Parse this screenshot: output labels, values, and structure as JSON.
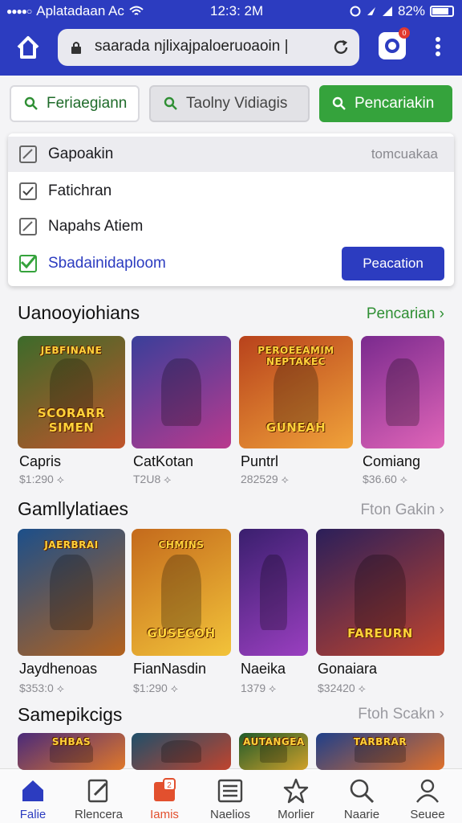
{
  "status": {
    "carrier": "Aplatadaan Ac",
    "time": "12:3: 2M",
    "battery": "82%"
  },
  "browser": {
    "url": "saarada njlixajpaloeruoaoin |",
    "tab_badge": "0"
  },
  "search_chips": [
    {
      "label": "Feriaegiann"
    },
    {
      "label": "Taolny Vidiagis"
    },
    {
      "label": "Pencariakin"
    }
  ],
  "panel": {
    "rows": [
      {
        "label": "Gapoakin",
        "hint": "tomcuakaa"
      },
      {
        "label": "Fatichran"
      },
      {
        "label": "Napahs Atiem"
      },
      {
        "label": "Sbadainidaploom",
        "action": "Peacation"
      }
    ]
  },
  "sections": [
    {
      "title": "Uanooyiohians",
      "link": "Pencarian",
      "items": [
        {
          "name": "Capris",
          "price": "$1:290",
          "caption_top": "JEBFINANE",
          "caption": "SCORARR SIMEN",
          "color1": "#3c6b2a",
          "color2": "#c0542b"
        },
        {
          "name": "CatKotan",
          "price": "T2U8",
          "caption": "",
          "color1": "#3a3f9a",
          "color2": "#b93a8e"
        },
        {
          "name": "Puntrl",
          "price": "282529",
          "caption_top": "PEROEEAMIM NEPTAKEC",
          "caption": "GUNEAH",
          "color1": "#b8421c",
          "color2": "#f0a23a"
        },
        {
          "name": "Comiang",
          "price": "$36.60",
          "caption": "",
          "color1": "#7a2a8e",
          "color2": "#e065b8"
        }
      ]
    },
    {
      "title": "Gamllylatiaes",
      "link": "Fton Gakin",
      "items": [
        {
          "name": "Jaydhenoas",
          "price": "$353:0",
          "caption_top": "JAERBRAI",
          "caption": "",
          "color1": "#1c4f8a",
          "color2": "#b3621e"
        },
        {
          "name": "FianNasdin",
          "price": "$1:290",
          "caption_top": "CHMINS",
          "caption": "GUSECOH",
          "color1": "#c46a1c",
          "color2": "#f2c33a"
        },
        {
          "name": "Naeika",
          "price": "1379",
          "caption": "",
          "color1": "#3a1f6e",
          "color2": "#9a3fc0"
        },
        {
          "name": "Gonaiara",
          "price": "$32420",
          "caption": "FAREURN",
          "color1": "#2b1f5a",
          "color2": "#c0442e"
        }
      ]
    },
    {
      "title": "Samepikcigs",
      "link": "Ftoh Scakn",
      "items": [
        {
          "name": "",
          "price": "",
          "caption_top": "SHBAS",
          "caption": "",
          "color1": "#4a2a7a",
          "color2": "#e0782a"
        },
        {
          "name": "",
          "price": "",
          "caption": "",
          "color1": "#1f4f6a",
          "color2": "#c0442e"
        },
        {
          "name": "",
          "price": "",
          "caption_top": "AUTANGEA",
          "caption": "",
          "color1": "#1f5a2a",
          "color2": "#d0a02a"
        },
        {
          "name": "",
          "price": "",
          "caption_top": "TARBRAR",
          "caption": "",
          "color1": "#1f3f8a",
          "color2": "#e0702a"
        }
      ]
    }
  ],
  "bottom_nav": [
    {
      "label": "Falie",
      "icon": "home-icon"
    },
    {
      "label": "Rlencera",
      "icon": "edit-icon"
    },
    {
      "label": "Iamis",
      "icon": "games-icon",
      "badge": "2"
    },
    {
      "label": "Naelios",
      "icon": "list-icon"
    },
    {
      "label": "Morlier",
      "icon": "star-icon"
    },
    {
      "label": "Naarie",
      "icon": "search-icon"
    },
    {
      "label": "Seuee",
      "icon": "profile-icon"
    }
  ],
  "colors": {
    "brand_blue": "#2c3cc0",
    "accent_green": "#35a33c",
    "badge_red": "#e2382e"
  }
}
